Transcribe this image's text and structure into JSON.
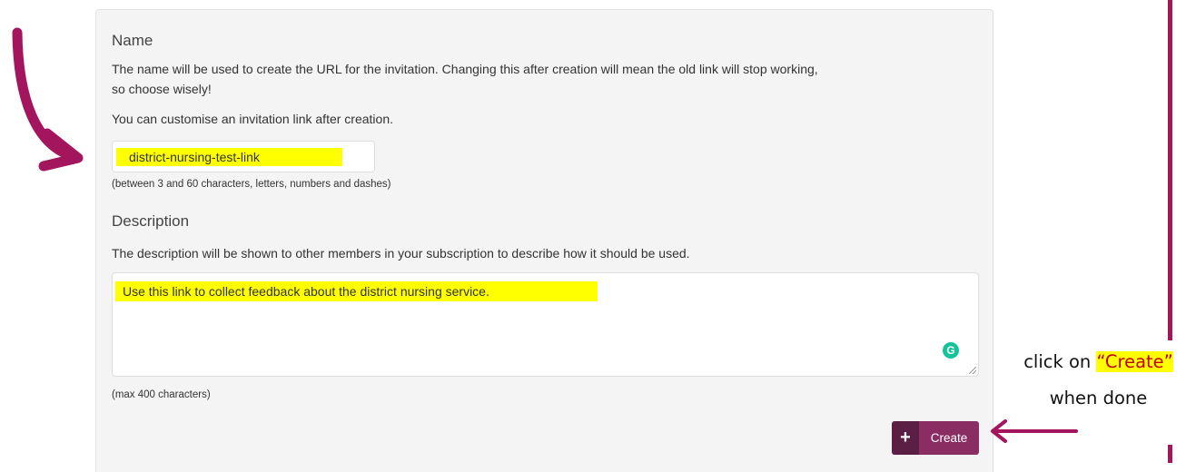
{
  "form": {
    "name_label": "Name",
    "name_help_line1": "The name will be used to create the URL for the invitation. Changing this after creation will mean the old link will stop working,",
    "name_help_line2": "so choose wisely!",
    "name_help_customise": "You can customise an invitation link after creation.",
    "name_value": "district-nursing-test-link",
    "name_hint": "(between 3 and 60 characters, letters, numbers and dashes)",
    "description_label": "Description",
    "description_help": "The description will be shown to other members in your subscription to describe how it should be used.",
    "description_value": "Use this link to collect feedback about the district nursing service.",
    "description_hint": "(max 400 characters)",
    "create_label": "Create",
    "grammarly_letter": "G"
  },
  "annotation": {
    "callout_prefix": "click on ",
    "callout_highlight": "“Create”",
    "callout_line2": "when done"
  },
  "colors": {
    "arrow": "#a3165e",
    "highlight": "#ffff00",
    "button_primary": "#8a2d63",
    "button_icon_bg": "#5b1e45"
  },
  "icons": {
    "create": "plus-icon",
    "grammarly": "grammarly-icon",
    "annotation_arrow_curved": "curved-arrow-icon",
    "annotation_arrow_left": "left-arrow-icon"
  }
}
